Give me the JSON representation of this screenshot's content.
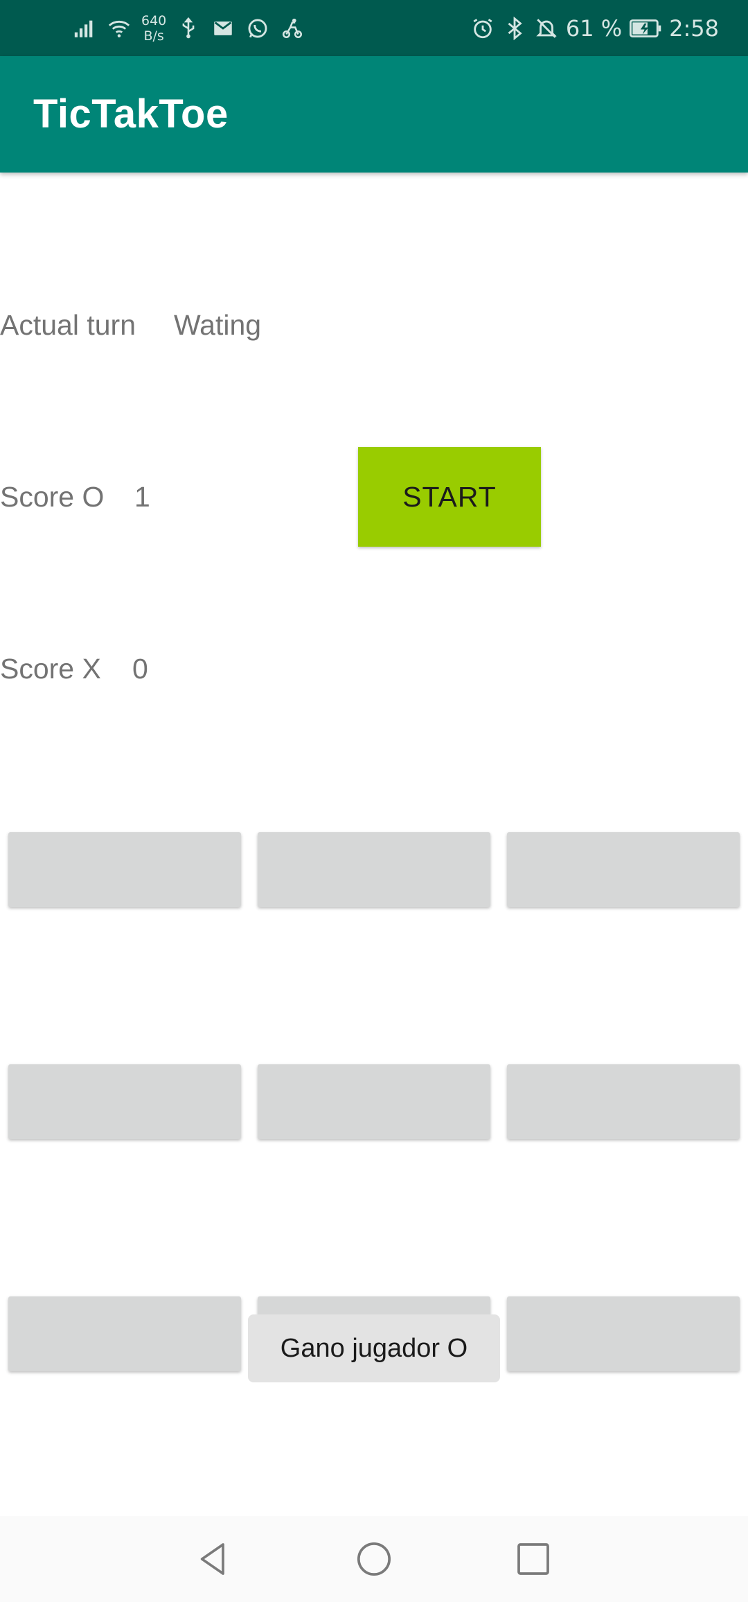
{
  "status_bar": {
    "net_speed_value": "640",
    "net_speed_unit": "B/s",
    "battery_text": "61 %",
    "time": "2:58",
    "left_icons": [
      "signal-icon",
      "wifi-icon",
      "usb-icon",
      "gmail-icon",
      "whatsapp-icon",
      "delivery-icon"
    ],
    "right_icons": [
      "alarm-icon",
      "bluetooth-icon",
      "silent-icon",
      "battery-charging-icon"
    ]
  },
  "app_bar": {
    "title": "TicTakToe"
  },
  "game": {
    "turn_label": "Actual turn",
    "turn_value": "Wating",
    "score_o_label": "Score O",
    "score_o_value": "1",
    "score_x_label": "Score X",
    "score_x_value": "0",
    "start_label": "START",
    "board": [
      [
        "",
        "",
        ""
      ],
      [
        "",
        "",
        ""
      ],
      [
        "",
        "",
        ""
      ]
    ]
  },
  "toast": {
    "message": "Gano jugador O"
  },
  "nav_bar": {
    "buttons": [
      "back-icon",
      "home-icon",
      "recents-icon"
    ]
  },
  "colors": {
    "status_bar": "#005a4f",
    "app_bar": "#008577",
    "start_button": "#99cc00",
    "cell": "#d6d7d7"
  }
}
